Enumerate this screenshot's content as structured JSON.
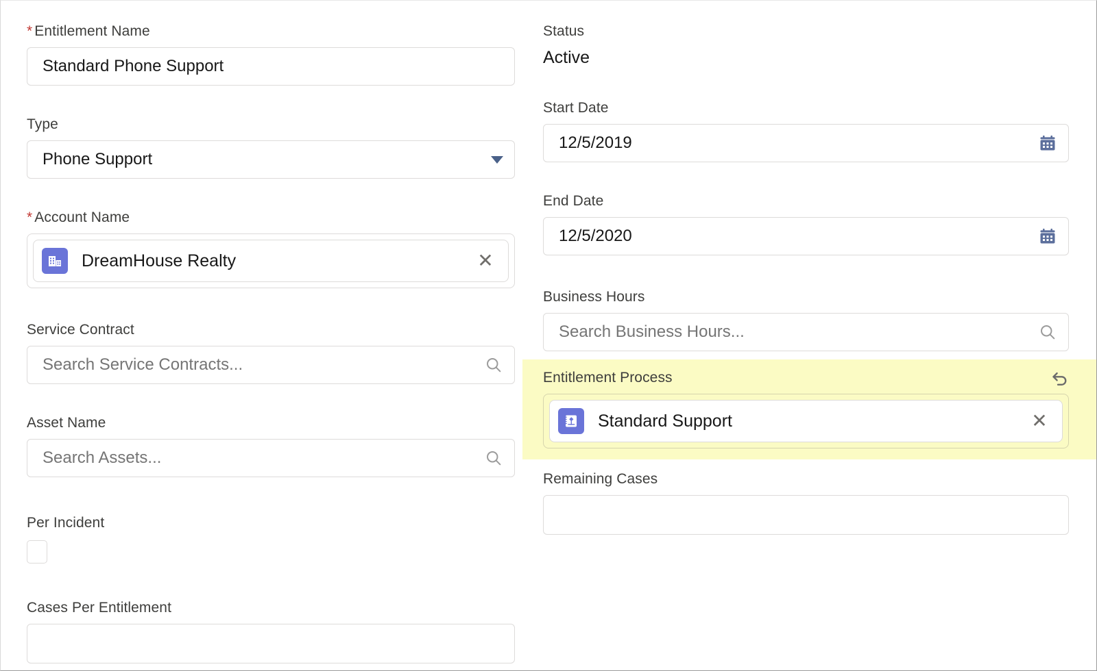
{
  "theme": {
    "required_star_color": "#c23934",
    "highlight_background": "#fbfbc4",
    "pill_icon_color": "#6a74d8",
    "calendar_icon_color": "#5c6f9c",
    "picklist_caret_color": "#4a6189",
    "border_color": "#dddbda",
    "label_color": "#3e3e3c",
    "value_color": "#181818",
    "placeholder_color": "#757575"
  },
  "left_column": {
    "entitlement_name": {
      "label": "Entitlement Name",
      "required_marker": "*",
      "value": "Standard Phone Support"
    },
    "type": {
      "label": "Type",
      "value": "Phone Support",
      "caret_icon": "chevron-down-icon"
    },
    "account_name": {
      "label": "Account Name",
      "required_marker": "*",
      "pill_value": "DreamHouse Realty",
      "pill_icon": "account-building-icon",
      "remove_icon": "close-icon"
    },
    "service_contract": {
      "label": "Service Contract",
      "placeholder": "Search Service Contracts...",
      "value": "",
      "search_icon": "search-icon"
    },
    "asset_name": {
      "label": "Asset Name",
      "placeholder": "Search Assets...",
      "value": "",
      "search_icon": "search-icon"
    },
    "per_incident": {
      "label": "Per Incident",
      "checked": false
    },
    "cases_per_entitlement": {
      "label": "Cases Per Entitlement",
      "value": ""
    }
  },
  "right_column": {
    "status": {
      "label": "Status",
      "value": "Active"
    },
    "start_date": {
      "label": "Start Date",
      "value": "12/5/2019",
      "calendar_icon": "calendar-icon"
    },
    "end_date": {
      "label": "End Date",
      "value": "12/5/2020",
      "calendar_icon": "calendar-icon"
    },
    "business_hours": {
      "label": "Business Hours",
      "placeholder": "Search Business Hours...",
      "value": "",
      "search_icon": "search-icon"
    },
    "entitlement_process": {
      "label": "Entitlement Process",
      "highlighted": true,
      "pill_value": "Standard Support",
      "pill_icon": "entitlement-process-icon",
      "remove_icon": "close-icon",
      "undo_icon": "undo-icon"
    },
    "remaining_cases": {
      "label": "Remaining Cases",
      "value": ""
    }
  }
}
